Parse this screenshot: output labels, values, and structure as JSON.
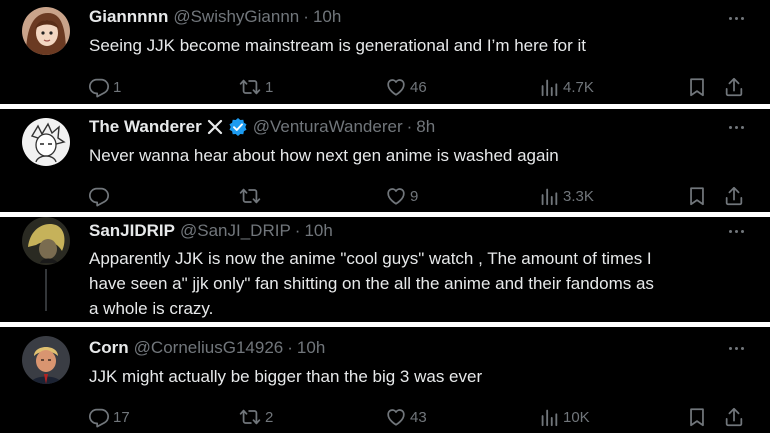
{
  "colors": {
    "background": "#000000",
    "text": "#e7e9ea",
    "muted": "#71767b",
    "verified": "#1d9bf0",
    "separator": "#ffffff"
  },
  "icons": {
    "reply": "speech-bubble-icon",
    "retweet": "retweet-arrows-icon",
    "like": "heart-icon",
    "views": "bar-chart-icon",
    "bookmark": "bookmark-icon",
    "share": "share-upload-icon",
    "more": "ellipsis-icon",
    "verified": "verified-checkmark-icon",
    "x_logo": "x-logo-icon"
  },
  "posts": [
    {
      "name": "Giannnnn",
      "handle": "@SwishyGiannn",
      "sep": "·",
      "time": "10h",
      "text": "Seeing JJK become mainstream is generational and I’m here for it",
      "replies": "1",
      "retweets": "1",
      "likes": "46",
      "views": "4.7K"
    },
    {
      "name": "The Wanderer",
      "handle": "@VenturaWanderer",
      "sep": "·",
      "time": "8h",
      "text": "Never wanna hear about how next gen anime is washed again",
      "replies": "",
      "retweets": "",
      "likes": "9",
      "views": "3.3K"
    },
    {
      "name": "SanJIDRIP",
      "handle": "@SanJI_DRIP",
      "sep": "·",
      "time": "10h",
      "lines": [
        "Apparently JJK is now the anime \"cool guys\" watch , The amount of times I",
        "have seen a\" jjk only\" fan shitting on the all the anime and their fandoms as",
        "a whole is crazy."
      ]
    },
    {
      "name": "Corn",
      "handle": "@CorneliusG14926",
      "sep": "·",
      "time": "10h",
      "text": "JJK might actually be bigger than the big 3 was ever",
      "replies": "17",
      "retweets": "2",
      "likes": "43",
      "views": "10K"
    }
  ]
}
